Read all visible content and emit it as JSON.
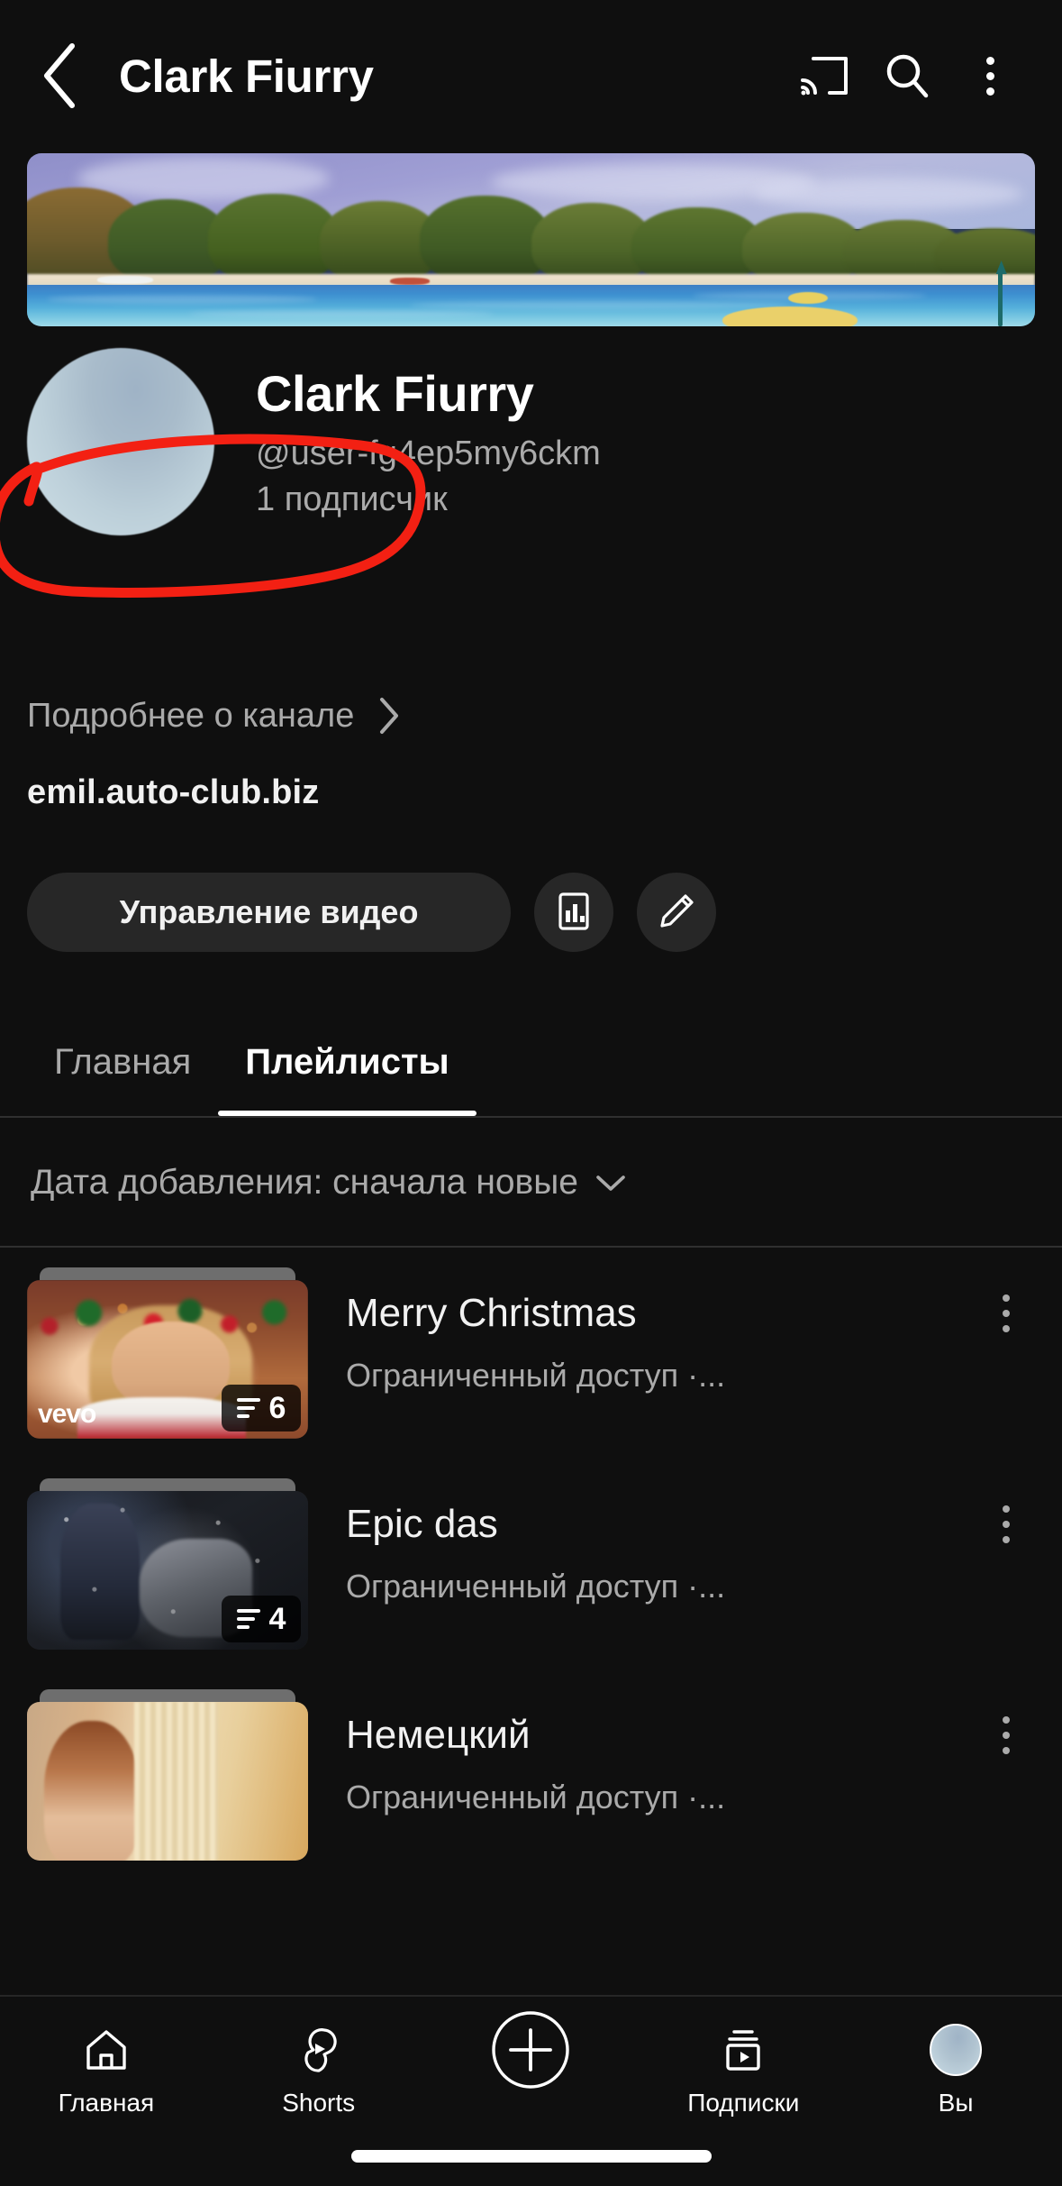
{
  "appbar": {
    "title": "Clark Fiurry",
    "back_icon": "back-arrow-icon",
    "cast_icon": "cast-icon",
    "search_icon": "search-icon",
    "more_icon": "more-vertical-icon"
  },
  "banner": {
    "alt": "tropical-island-lagoon-banner"
  },
  "channel": {
    "name": "Clark Fiurry",
    "handle": "@user-fg4ep5my6ckm",
    "subscribers": "1 подписчик",
    "about_label": "Подробнее о канале",
    "about_chevron": "chevron-right-icon",
    "website": "emil.auto-club.biz",
    "avatar": "channel-avatar"
  },
  "actions": {
    "manage_videos_label": "Управление видео",
    "analytics_icon": "bar-chart-icon",
    "edit_icon": "pencil-icon"
  },
  "tabs": [
    {
      "label": "Главная",
      "active": false
    },
    {
      "label": "Плейлисты",
      "active": true
    }
  ],
  "sort": {
    "label": "Дата добавления: сначала новые",
    "chevron": "chevron-down-icon"
  },
  "playlists": [
    {
      "title": "Merry Christmas",
      "subtitle": "Ограниченный доступ ·...",
      "count": "6",
      "thumb_style": "xmas",
      "watermark": "vevo",
      "menu_icon": "more-vertical-icon"
    },
    {
      "title": "Epic das",
      "subtitle": "Ограниченный доступ ·...",
      "count": "4",
      "thumb_style": "dark",
      "watermark": "",
      "menu_icon": "more-vertical-icon"
    },
    {
      "title": "Немецкий",
      "subtitle": "Ограниченный доступ ·...",
      "count": "",
      "thumb_style": "warm",
      "watermark": "",
      "menu_icon": "more-vertical-icon"
    }
  ],
  "bottom_nav": [
    {
      "label": "Главная",
      "icon": "home-icon"
    },
    {
      "label": "Shorts",
      "icon": "shorts-icon"
    },
    {
      "label": "",
      "icon": "create-plus-icon"
    },
    {
      "label": "Подписки",
      "icon": "subscriptions-icon"
    },
    {
      "label": "Вы",
      "icon": "account-avatar-icon"
    }
  ],
  "annotation": {
    "type": "hand-drawn-red-circle",
    "color": "#f32013"
  }
}
